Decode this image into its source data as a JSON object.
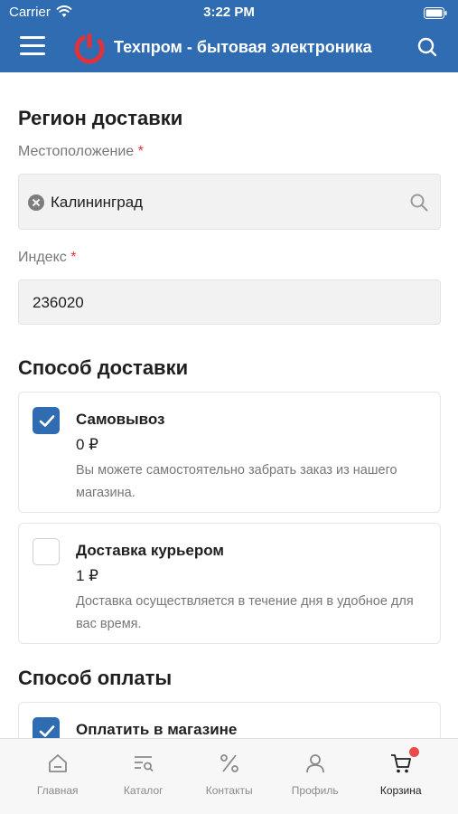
{
  "status_bar": {
    "carrier": "Carrier",
    "time": "3:22 PM"
  },
  "header": {
    "title": "Техпром - бытовая электроника"
  },
  "region": {
    "title": "Регион доставки",
    "location_label": "Местоположение",
    "location_required": "*",
    "location_value": "Калининград",
    "index_label": "Индекс",
    "index_required": "*",
    "index_value": "236020"
  },
  "delivery": {
    "title": "Способ доставки",
    "options": [
      {
        "name": "Самовывоз",
        "price": "0 ₽",
        "description": "Вы можете самостоятельно забрать заказ из нашего магазина.",
        "checked": true
      },
      {
        "name": "Доставка курьером",
        "price": "1 ₽",
        "description": "Доставка осуществляется в течение дня в удобное для вас время.",
        "checked": false
      }
    ]
  },
  "payment": {
    "title": "Способ оплаты",
    "options": [
      {
        "name": "Оплатить в магазине",
        "checked": true
      }
    ]
  },
  "tabs": [
    {
      "label": "Главная",
      "icon": "home-icon"
    },
    {
      "label": "Каталог",
      "icon": "catalog-icon"
    },
    {
      "label": "Контакты",
      "icon": "percent-icon"
    },
    {
      "label": "Профиль",
      "icon": "profile-icon"
    },
    {
      "label": "Корзина",
      "icon": "cart-icon",
      "active": true
    }
  ],
  "colors": {
    "brand": "#2f6cb2",
    "required": "#e0323b",
    "badge": "#e94b4b"
  }
}
